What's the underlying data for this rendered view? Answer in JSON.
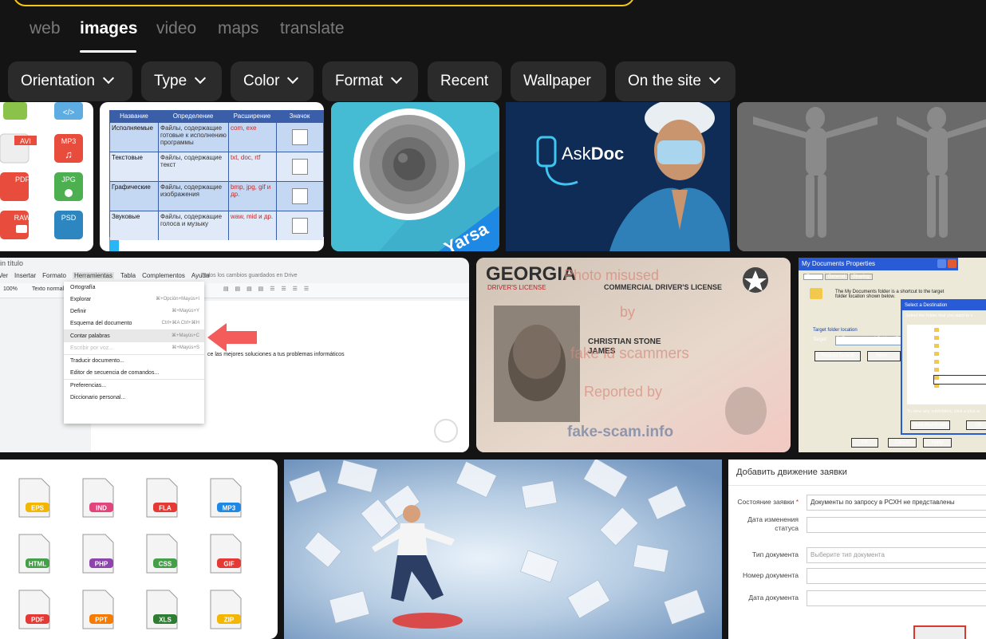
{
  "nav": {
    "tabs": [
      {
        "label": "web",
        "active": false
      },
      {
        "label": "images",
        "active": true
      },
      {
        "label": "video",
        "active": false
      },
      {
        "label": "maps",
        "active": false
      },
      {
        "label": "translate",
        "active": false
      }
    ]
  },
  "filters": {
    "orientation": "Orientation",
    "type": "Type",
    "color": "Color",
    "format": "Format",
    "recent": "Recent",
    "wallpaper": "Wallpaper",
    "on_the_site": "On the site"
  },
  "results": {
    "tile_files": {
      "badges": [
        "AVI",
        "MP3",
        "PDF",
        "JPG",
        "RAW",
        "PSD"
      ]
    },
    "tile_table": {
      "headers": [
        "Название",
        "Определение",
        "Расширение",
        "Значок"
      ],
      "rows": [
        {
          "name": "Исполняемые",
          "def": "Файлы, содержащие готовые к исполнению программы",
          "ext": "com, exe"
        },
        {
          "name": "Текстовые",
          "def": "Файлы, содержащие текст",
          "ext": "txt, doc, rtf"
        },
        {
          "name": "Графические",
          "def": "Файлы, содержащие изображения",
          "ext": "bmp, jpg, gif и др."
        },
        {
          "name": "Звуковые",
          "def": "Файлы, содержащие голоса и музыку",
          "ext": "waw, mid и др."
        }
      ]
    },
    "tile_camera": {
      "brand": "Yarsa"
    },
    "tile_askdoc": {
      "brand_a": "Ask",
      "brand_b": "Doc"
    },
    "tile_docs": {
      "title": "in título",
      "menubar": [
        "Ver",
        "Insertar",
        "Formato",
        "Herramientas",
        "Tabla",
        "Complementos",
        "Ayuda"
      ],
      "saved": "Todos los cambios guardados en Drive",
      "menu_items": [
        {
          "label": "Ortografía",
          "shortcut": ""
        },
        {
          "label": "Explorar",
          "shortcut": "⌘+Opción+Mayús+I"
        },
        {
          "label": "Definir",
          "shortcut": "⌘+Mayús+Y"
        },
        {
          "label": "Esquema del documento",
          "shortcut": "Ctrl+⌘A Ctrl+⌘H"
        },
        {
          "label": "Contar palabras",
          "shortcut": "⌘+Mayús+C"
        },
        {
          "label": "Escribir por voz...",
          "shortcut": "⌘+Mayús+S"
        },
        {
          "label": "Traducir documento...",
          "shortcut": ""
        },
        {
          "label": "Editor de secuencia de comandos...",
          "shortcut": ""
        },
        {
          "label": "Preferencias...",
          "shortcut": ""
        },
        {
          "label": "Diccionario personal...",
          "shortcut": ""
        }
      ],
      "body_text": "ce las mejores soluciones a tus problemas informáticos",
      "zoom": "100%",
      "style": "Texto normal"
    },
    "tile_license": {
      "state": "GEORGIA",
      "subtitle": "DRIVER'S LICENSE",
      "cdl": "COMMERCIAL DRIVER'S LICENSE",
      "name1": "CHRISTIAN STONE",
      "name2": "JAMES",
      "wm1": "Photo misused",
      "wm2": "by",
      "wm3": "fake id scammers",
      "wm4": "Reported by",
      "wm5": "fake-scam.info"
    },
    "tile_xp": {
      "title": "My Documents Properties",
      "tabs": [
        "Target",
        "General",
        "Sharing"
      ],
      "info": "The My Documents folder is a shortcut to the target folder location shown below.",
      "group": "Target folder location",
      "target_label": "Target:",
      "target_value": "C:\\Documents and Settings\\F",
      "btn_restore": "Restore Default",
      "btn_move": "Move...",
      "btn_ok": "OK",
      "btn_cancel": "Cancel",
      "btn_apply": "Apply",
      "dialog_title": "Select a Destination",
      "dialog_text": "Select the folder that you want to s",
      "folders": [
        "Hafiz",
        "Master",
        "MSOCache",
        "MSP8 Preview Files",
        "My Documents",
        "MyWorks",
        "Dokumenku",
        "Orlansoft 1.7.1 - B3"
      ],
      "subtext": "To view any subfolders, click a plus si",
      "btn_newfolder": "Make New Folder",
      "btn_ok2": "OK"
    },
    "tile_icons": {
      "badges": [
        "EPS",
        "IND",
        "FLA",
        "MP3",
        "HTML",
        "PHP",
        "CSS",
        "GIF",
        "PDF",
        "PPT",
        "XLS",
        "ZIP"
      ]
    },
    "tile_form": {
      "title": "Добавить движение заявки",
      "fields": [
        {
          "label": "Состояние заявки",
          "value": "Документы по запросу в РСХН не представлены",
          "required": true
        },
        {
          "label": "Дата изменения статуса",
          "value": "",
          "required": false
        },
        {
          "label": "Тип документа",
          "value": "Выберите тип документа",
          "required": false
        },
        {
          "label": "Номер документа",
          "value": "",
          "required": false
        },
        {
          "label": "Дата документа",
          "value": "",
          "required": false
        }
      ]
    }
  },
  "colors": {
    "background": "#141414",
    "chip": "#2b2b2b",
    "search_border": "#f5c518"
  }
}
